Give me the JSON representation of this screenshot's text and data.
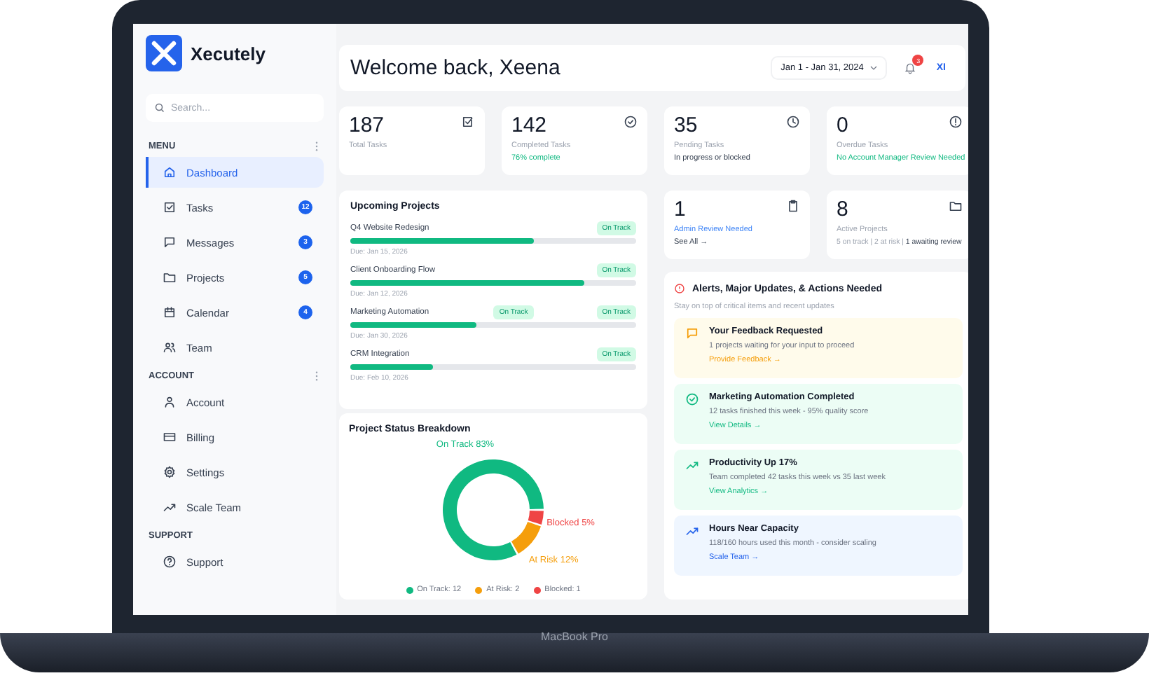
{
  "brand": {
    "name": "Xecutely"
  },
  "search": {
    "placeholder": "Search..."
  },
  "sidebar": {
    "sections": [
      {
        "title": "MENU",
        "has_menu": true,
        "items": [
          {
            "label": "Dashboard",
            "selected": true
          },
          {
            "label": "Tasks",
            "selected": false,
            "badge": "12"
          },
          {
            "label": "Messages",
            "selected": false,
            "badge": "3"
          },
          {
            "label": "Projects",
            "selected": false,
            "badge": "5"
          },
          {
            "label": "Calendar",
            "selected": false,
            "badge": "4"
          },
          {
            "label": "Team",
            "selected": false
          }
        ]
      },
      {
        "title": "ACCOUNT",
        "has_menu": true,
        "items": [
          {
            "label": "Account",
            "selected": false
          },
          {
            "label": "Billing",
            "selected": false
          },
          {
            "label": "Settings",
            "selected": false
          },
          {
            "label": "Scale Team",
            "selected": false
          }
        ]
      },
      {
        "title": "SUPPORT",
        "has_menu": false,
        "items": [
          {
            "label": "Support",
            "selected": false
          }
        ]
      }
    ]
  },
  "header": {
    "title": "Welcome back, Xeena",
    "date_range": "Jan 1 - Jan 31, 2024",
    "notifications": "3",
    "avatar": "XI"
  },
  "stats": [
    {
      "value": "187",
      "label": "Total Tasks"
    },
    {
      "value": "142",
      "label": "Completed Tasks",
      "note": "76% complete",
      "kind": "success"
    },
    {
      "value": "35",
      "label": "Pending Tasks",
      "note": "In progress or blocked",
      "kind": "plain"
    },
    {
      "value": "0",
      "label": "Overdue Tasks",
      "note": "No Account Manager Review Needed",
      "kind": "success"
    },
    {
      "value": "1",
      "note": "Admin Review Needed",
      "kind": "info",
      "link": "See All →"
    },
    {
      "value": "8",
      "label": "Active Projects",
      "note": "5 on track | 2 at risk | **1 awaiting review**",
      "kind": "muted"
    }
  ],
  "upcoming": {
    "title": "Upcoming Projects",
    "projects": [
      {
        "name": "Q4 Website Redesign",
        "level": 0.64,
        "due": "Due: Jan 15, 2026",
        "badges": [
          "On Track"
        ]
      },
      {
        "name": "Client Onboarding Flow",
        "level": 0.82,
        "due": "Due: Jan 12, 2026",
        "badges": [
          "On Track"
        ]
      },
      {
        "name": "Marketing Automation",
        "level": 0.44,
        "due": "Due: Jan 30, 2026",
        "badges": [
          "On Track",
          "On Track"
        ]
      },
      {
        "name": "CRM Integration",
        "level": 0.29,
        "due": "Due: Feb 10, 2026",
        "badges": [
          "On Track"
        ]
      }
    ]
  },
  "status_breakdown": {
    "title": "Project Status Breakdown",
    "chart_data": {
      "type": "donut",
      "categories": [
        "On Track",
        "At Risk",
        "Blocked"
      ],
      "values": [
        83,
        12,
        5
      ],
      "value_labels": [
        "83%",
        "12%",
        "5%"
      ]
    },
    "legend": [
      {
        "label": "On Track: 12",
        "color": "#10b981"
      },
      {
        "label": "At Risk: 2",
        "color": "#f59e0b"
      },
      {
        "label": "Blocked: 1",
        "color": "#ef4444"
      }
    ]
  },
  "alerts": {
    "title": "Alerts, Major Updates, & Actions Needed",
    "subtitle": "Stay on top of critical items and recent updates",
    "items": [
      {
        "kind": "feedback",
        "title": "Your Feedback Requested",
        "text": "1 projects waiting for your input to proceed",
        "link": "Provide Feedback →"
      },
      {
        "kind": "done",
        "title": "Marketing Automation Completed",
        "text": "12 tasks finished this week - 95% quality score",
        "link": "View Details →"
      },
      {
        "kind": "growth",
        "title": "Productivity Up 17%",
        "text": "Team completed 42 tasks this week vs 35 last week",
        "link": "View Analytics →"
      },
      {
        "kind": "capacity",
        "title": "Hours Near Capacity",
        "text": "118/160 hours used this month - consider scaling",
        "link": "Scale Team →"
      }
    ]
  },
  "device": {
    "label": "MacBook Pro"
  }
}
